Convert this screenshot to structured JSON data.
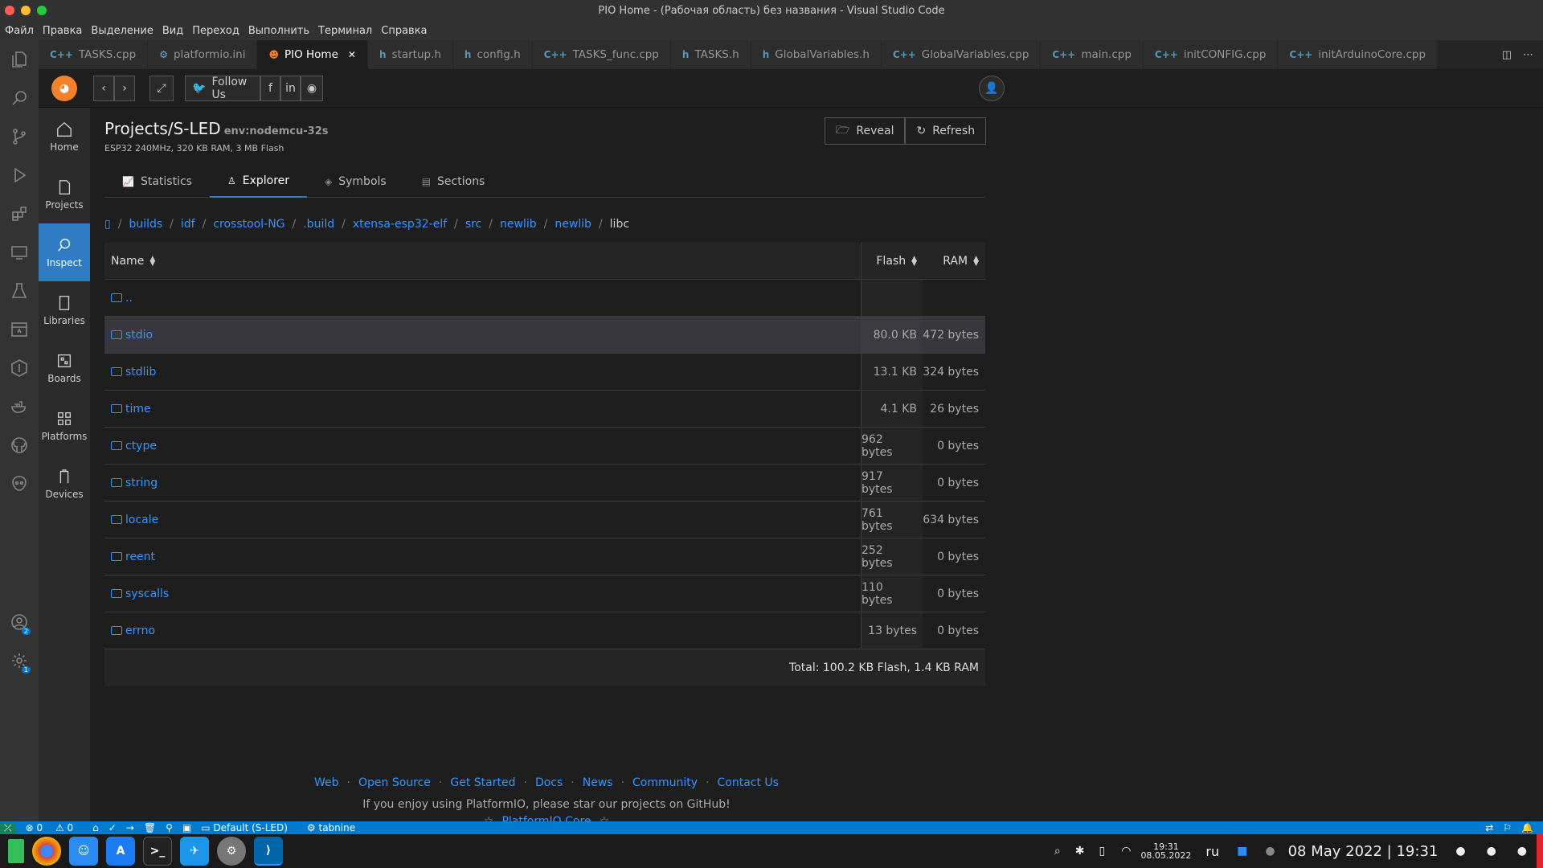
{
  "window": {
    "title": "PIO Home - (Рабочая область) без названия - Visual Studio Code"
  },
  "menu": [
    "Файл",
    "Правка",
    "Выделение",
    "Вид",
    "Переход",
    "Выполнить",
    "Терминал",
    "Справка"
  ],
  "tabs": [
    {
      "label": "TASKS.cpp",
      "icon": "C++"
    },
    {
      "label": "platformio.ini",
      "icon": "⚙"
    },
    {
      "label": "PIO Home",
      "icon": "☻",
      "active": true
    },
    {
      "label": "startup.h",
      "icon": "h"
    },
    {
      "label": "config.h",
      "icon": "h"
    },
    {
      "label": "TASKS_func.cpp",
      "icon": "C++"
    },
    {
      "label": "TASKS.h",
      "icon": "h"
    },
    {
      "label": "GlobalVariables.h",
      "icon": "h"
    },
    {
      "label": "GlobalVariables.cpp",
      "icon": "C++"
    },
    {
      "label": "main.cpp",
      "icon": "C++"
    },
    {
      "label": "initCONFIG.cpp",
      "icon": "C++"
    },
    {
      "label": "initArduinoCore.cpp",
      "icon": "C++"
    }
  ],
  "pio_header": {
    "follow_us": "Follow Us"
  },
  "pio_sidebar": [
    "Home",
    "Projects",
    "Inspect",
    "Libraries",
    "Boards",
    "Platforms",
    "Devices"
  ],
  "project": {
    "title": "Projects/S-LED",
    "env": "env:nodemcu-32s",
    "subtitle": "ESP32 240MHz, 320 KB RAM, 3 MB Flash",
    "reveal": "Reveal",
    "refresh": "Refresh"
  },
  "page_tabs": [
    "Statistics",
    "Explorer",
    "Symbols",
    "Sections"
  ],
  "breadcrumbs": [
    "builds",
    "idf",
    "crosstool-NG",
    ".build",
    "xtensa-esp32-elf",
    "src",
    "newlib",
    "newlib",
    "libc"
  ],
  "table": {
    "headers": {
      "name": "Name",
      "flash": "Flash",
      "ram": "RAM"
    },
    "parent": "..",
    "rows": [
      {
        "name": "stdio",
        "flash": "80.0 KB",
        "ram": "472 bytes"
      },
      {
        "name": "stdlib",
        "flash": "13.1 KB",
        "ram": "324 bytes"
      },
      {
        "name": "time",
        "flash": "4.1 KB",
        "ram": "26 bytes"
      },
      {
        "name": "ctype",
        "flash": "962 bytes",
        "ram": "0 bytes"
      },
      {
        "name": "string",
        "flash": "917 bytes",
        "ram": "0 bytes"
      },
      {
        "name": "locale",
        "flash": "761 bytes",
        "ram": "634 bytes"
      },
      {
        "name": "reent",
        "flash": "252 bytes",
        "ram": "0 bytes"
      },
      {
        "name": "syscalls",
        "flash": "110 bytes",
        "ram": "0 bytes"
      },
      {
        "name": "errno",
        "flash": "13 bytes",
        "ram": "0 bytes"
      }
    ],
    "total": "Total: 100.2 KB Flash, 1.4 KB RAM"
  },
  "footer": {
    "links": [
      "Web",
      "Open Source",
      "Get Started",
      "Docs",
      "News",
      "Community",
      "Contact Us"
    ],
    "message": "If you enjoy using PlatformIO, please star our projects on GitHub!",
    "core": "PlatformIO Core"
  },
  "statusbar": {
    "problems": "0",
    "warnings": "0",
    "env": "Default (S-LED)",
    "tabnine": "tabnine"
  },
  "taskbar": {
    "time_small": "19:31",
    "date_small": "08.05.2022",
    "lang": "ru",
    "datetime": "08 May 2022 | 19:31"
  },
  "badges": {
    "accounts": "2",
    "settings": "1"
  }
}
